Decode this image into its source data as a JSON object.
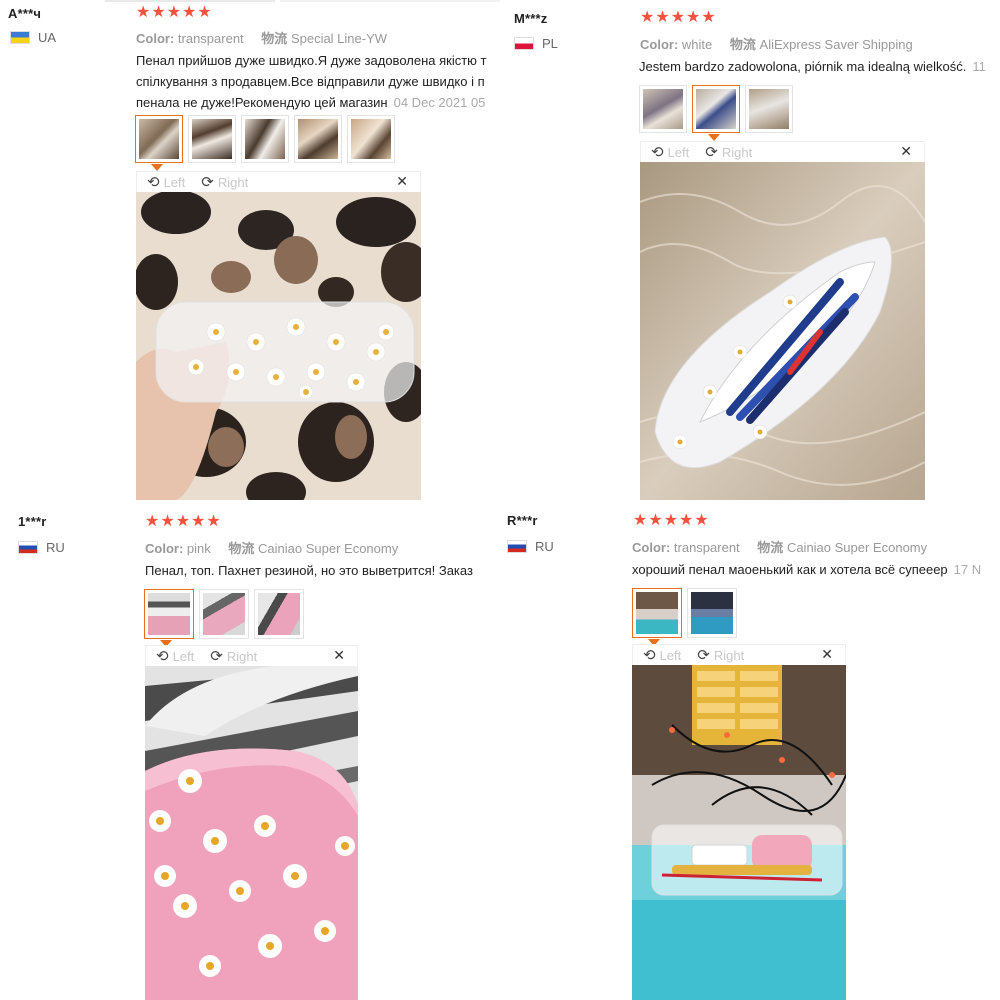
{
  "reviews": [
    {
      "user": "А***ч",
      "country": "UA",
      "stars": "★★★★★",
      "color_label": "Color:",
      "color_value": "transparent",
      "shipping_label": "物流",
      "shipping_value": "Special Line-YW",
      "text_lines": [
        "Пенал прийшов дуже швидко.Я дуже задоволена якістю т",
        "спілкування з продавцем.Все відправили дуже швидко і п",
        "пенала не дуже!Рекомендую цей магазин"
      ],
      "date": "04 Dec 2021 05",
      "viewer_left": "Left",
      "viewer_right": "Right",
      "close": "✕"
    },
    {
      "user": "M***z",
      "country": "PL",
      "stars": "★★★★★",
      "color_label": "Color:",
      "color_value": "white",
      "shipping_label": "物流",
      "shipping_value": "AliExpress Saver Shipping",
      "text_lines": [
        "Jestem bardzo zadowolona, piórnik ma idealną wielkość."
      ],
      "date": "11",
      "viewer_left": "Left",
      "viewer_right": "Right",
      "close": "✕"
    },
    {
      "user": "1***r",
      "country": "RU",
      "stars": "★★★★★",
      "color_label": "Color:",
      "color_value": "pink",
      "shipping_label": "物流",
      "shipping_value": "Cainiao Super Economy",
      "text_lines": [
        "Пенал, топ. Пахнет резиной, но это выветрится! Заказ"
      ],
      "date": "",
      "viewer_left": "Left",
      "viewer_right": "Right",
      "close": "✕"
    },
    {
      "user": "R***r",
      "country": "RU",
      "stars": "★★★★★",
      "color_label": "Color:",
      "color_value": "transparent",
      "shipping_label": "物流",
      "shipping_value": "Cainiao Super Economy",
      "text_lines": [
        "хороший пенал маоенький как и хотела всё супееер"
      ],
      "date": "17 N",
      "viewer_left": "Left",
      "viewer_right": "Right",
      "close": "✕"
    }
  ],
  "icons": {
    "rotate_left": "rotate-left-icon",
    "rotate_right": "rotate-right-icon",
    "close": "close-icon",
    "flag": "flag-icon",
    "star": "star-icon"
  },
  "colors": {
    "star": "#f5513f",
    "selected_thumb": "#e86f1c"
  }
}
